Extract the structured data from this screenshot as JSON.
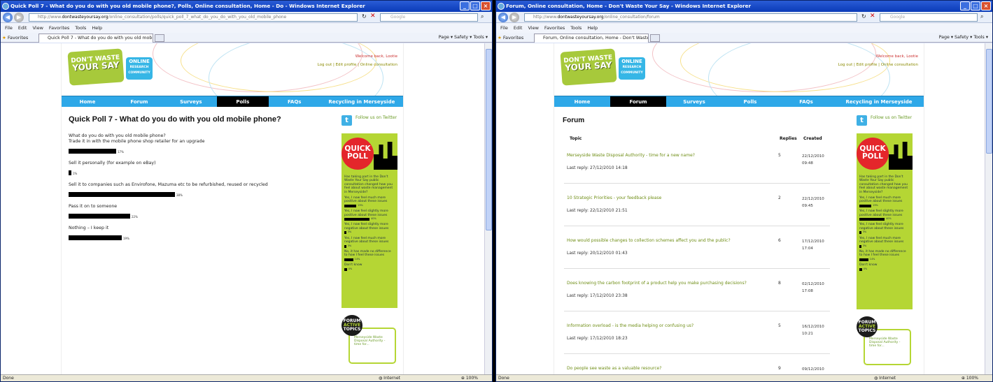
{
  "left": {
    "title": "Quick Poll 7 - What do you do with you old mobile phone?, Polls, Online consultation, Home - Do - Windows Internet Explorer",
    "address_prefix": "http://www.",
    "address_domain": "dontwasteyoursay.org",
    "address_path": "/online_consultation/polls/quick_poll_7_what_do_you_do_with_you_old_mobile_phone",
    "tab_label": "Quick Poll 7 - What do you do with you old mobile pho...",
    "status_left": "Done",
    "status_zone": "Internet",
    "status_zoom": "100%"
  },
  "right": {
    "title": "Forum, Online consultation, Home - Don't Waste Your Say - Windows Internet Explorer",
    "address_prefix": "http://www.",
    "address_domain": "dontwasteyoursay.org",
    "address_path": "/online_consultation/forum",
    "tab_label": "Forum, Online consultation, Home - Don't Waste Your ...",
    "status_left": "Done",
    "status_zone": "Internet",
    "status_zoom": "100%"
  },
  "browser": {
    "menu": [
      "File",
      "Edit",
      "View",
      "Favorites",
      "Tools",
      "Help"
    ],
    "favorites": "Favorites",
    "search_placeholder": "Google",
    "commands": "Page ▾   Safety ▾   Tools ▾"
  },
  "site": {
    "logo_line1": "DON'T WASTE",
    "logo_line2": "YOUR SAY",
    "logo2_line1": "ONLINE",
    "logo2_line2": "RESEARCH COMMUNITY",
    "welcome": "Welcome back, Lootie",
    "links": "Log out | Edit profile | Online consultation",
    "nav": [
      "Home",
      "Forum",
      "Surveys",
      "Polls",
      "FAQs",
      "Recycling in Merseyside"
    ],
    "follow": "Follow us on Twitter",
    "twitter_icon": "t"
  },
  "poll": {
    "heading": "Quick Poll 7 - What do you do with you old mobile phone?",
    "question": "What do you do with you old mobile phone?",
    "options": [
      {
        "label": "Trade it in with the mobile phone shop retailer for an upgrade",
        "percent": 17
      },
      {
        "label": "Sell it personally (for example on eBay)",
        "percent": 1
      },
      {
        "label": "Sell it to companies such as Envirofone, Mazuma etc to be refurbished, reused or recycled",
        "percent": 38
      },
      {
        "label": "Pass it on to someone",
        "percent": 22
      },
      {
        "label": "Nothing – I keep it",
        "percent": 19
      }
    ]
  },
  "quickpoll": {
    "title1": "QUICK",
    "title2": "POLL",
    "question": "Has taking part in the Don't Waste Your Say public consultation changed how you feel about waste management in Merseyside?",
    "options": [
      {
        "label": "Yes, I now feel much more positive about these issues",
        "percent": 19
      },
      {
        "label": "Yes, I now feel slightly more positive about these issues",
        "percent": 40
      },
      {
        "label": "Yes, I now feel slightly more negative about these issues",
        "percent": 3
      },
      {
        "label": "Yes, I now feel much more negative about these issues",
        "percent": 3
      },
      {
        "label": "No, it has made no difference to how I feel these issues",
        "percent": 14
      },
      {
        "label": "Don't know",
        "percent": 4
      }
    ]
  },
  "forum_topics": {
    "line1": "FORUM",
    "line2": "ACTIVE",
    "line3": "TOPICS",
    "first_topic": "Merseyside Waste Disposal Authority - time for..."
  },
  "forum": {
    "heading": "Forum",
    "col_topic": "Topic",
    "col_replies": "Replies",
    "col_created": "Created",
    "rows": [
      {
        "topic": "Merseyside Waste Disposal Authority - time for a new name?",
        "last_reply": "Last reply: 27/12/2010 14:18",
        "replies": "5",
        "date": "22/12/2010",
        "time": "09:48"
      },
      {
        "topic": "10 Strategic Priorities - your feedback please",
        "last_reply": "Last reply: 22/12/2010 21:51",
        "replies": "2",
        "date": "22/12/2010",
        "time": "09:45"
      },
      {
        "topic": "How would possible changes to collection schemes affect you and the public?",
        "last_reply": "Last reply: 20/12/2010 01:43",
        "replies": "6",
        "date": "17/12/2010",
        "time": "17:04"
      },
      {
        "topic": "Does knowing the carbon footprint of a product help you make purchasing decisions?",
        "last_reply": "Last reply: 17/12/2010 23:38",
        "replies": "8",
        "date": "02/12/2010",
        "time": "17:08"
      },
      {
        "topic": "Information overload - is the media helping or confusing us?",
        "last_reply": "Last reply: 17/12/2010 18:23",
        "replies": "5",
        "date": "16/12/2010",
        "time": "10:21"
      },
      {
        "topic": "Do people see waste as a valuable resource?",
        "last_reply": "",
        "replies": "9",
        "date": "09/12/2010",
        "time": ""
      }
    ]
  },
  "colors": {
    "nav_blue": "#2ea8e8",
    "green": "#b5d634",
    "red": "#e4262b",
    "link_green": "#6e8d14"
  }
}
